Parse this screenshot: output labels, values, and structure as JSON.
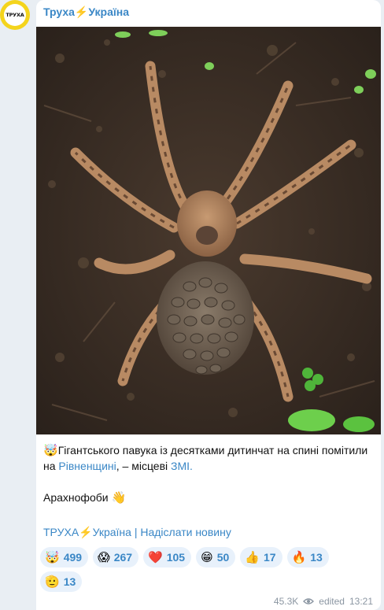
{
  "channel": {
    "avatar_text": "ТРУХА",
    "name": "Труха⚡Україна"
  },
  "post": {
    "image_alt": "Тарантул з дитинчатами на спині",
    "lead_emoji": "🤯",
    "text_part1": "Гігантського павука із десятками дитинчат на спині помітили на ",
    "text_link": "Рівненщині",
    "text_part2": ", – місцеві ",
    "text_link2": "ЗМІ.",
    "line2": "Арахнофоби ",
    "line2_emoji": "👋",
    "footer_links": "ТРУХА⚡Україна | Надіслати новину"
  },
  "reactions": [
    {
      "emoji": "🤯",
      "count": "499"
    },
    {
      "emoji": "😱",
      "count": "267"
    },
    {
      "emoji": "❤️",
      "count": "105"
    },
    {
      "emoji": "😁",
      "count": "50"
    },
    {
      "emoji": "👍",
      "count": "17"
    },
    {
      "emoji": "🔥",
      "count": "13"
    },
    {
      "emoji": "🫡",
      "count": "13"
    }
  ],
  "meta": {
    "views": "45.3K",
    "edited_label": "edited",
    "time": "13:21"
  },
  "colors": {
    "accent": "#3a87c6",
    "avatar_ring": "#f4d41c",
    "background": "#e9eef3",
    "reaction_bg": "#e8f1fb"
  }
}
